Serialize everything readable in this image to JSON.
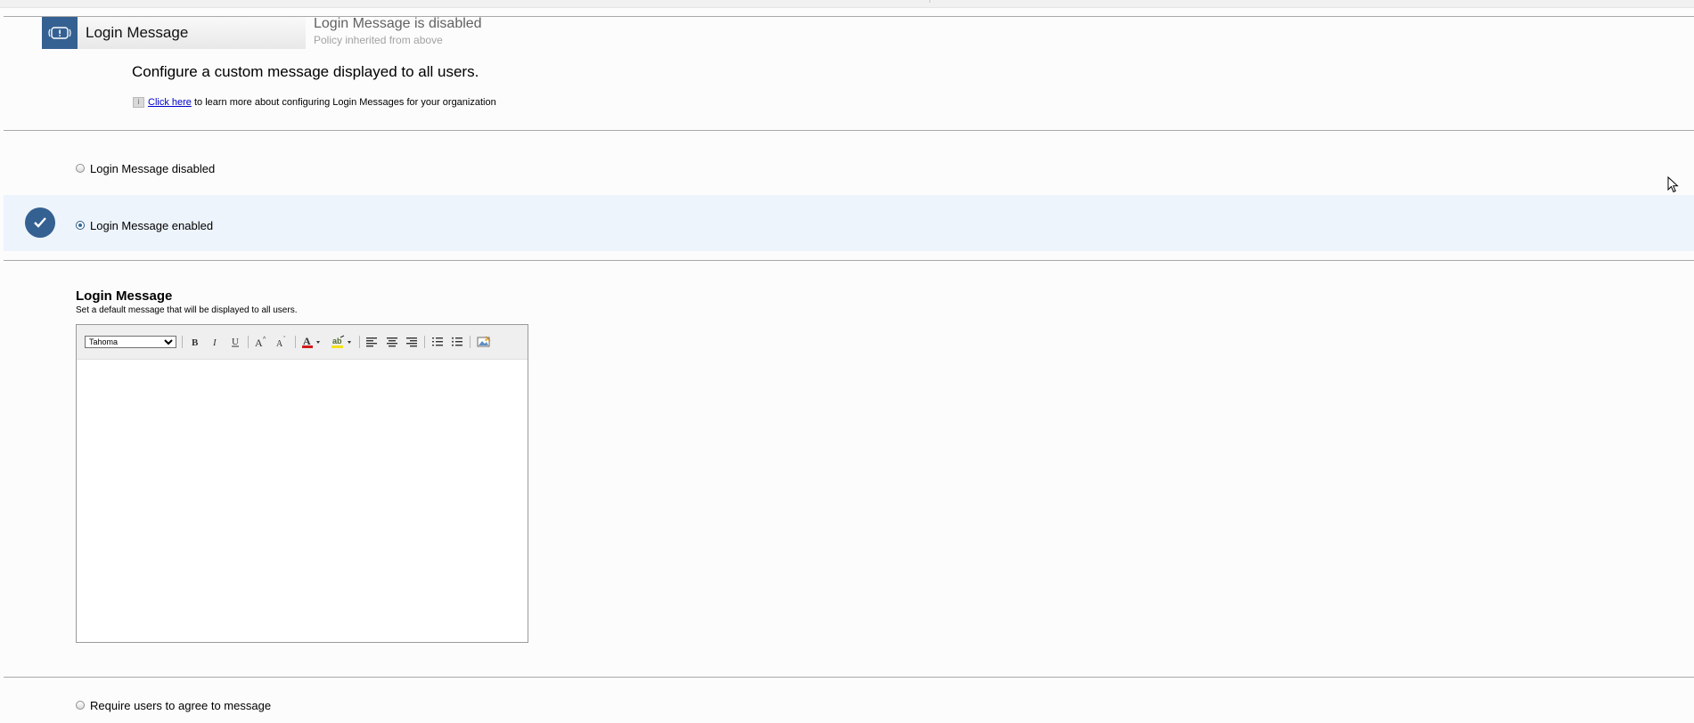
{
  "policy": {
    "tab_label": "Login Message",
    "status_title": "Login Message is disabled",
    "status_sub": "Policy inherited from above"
  },
  "description": "Configure a custom message displayed to all users.",
  "info": {
    "link_text": "Click here",
    "rest_text": " to learn more about configuring Login Messages for your organization"
  },
  "options": {
    "disabled_label": "Login Message disabled",
    "enabled_label": "Login Message enabled",
    "selected": "enabled"
  },
  "message_section": {
    "title": "Login Message",
    "subtitle": "Set a default message that will be displayed to all users."
  },
  "editor": {
    "font_value": "Tahoma",
    "content": ""
  },
  "agree_label": "Require users to agree to message",
  "colors": {
    "brand_blue": "#356092",
    "enabled_band": "#edf4fc",
    "link": "#0000cc"
  }
}
